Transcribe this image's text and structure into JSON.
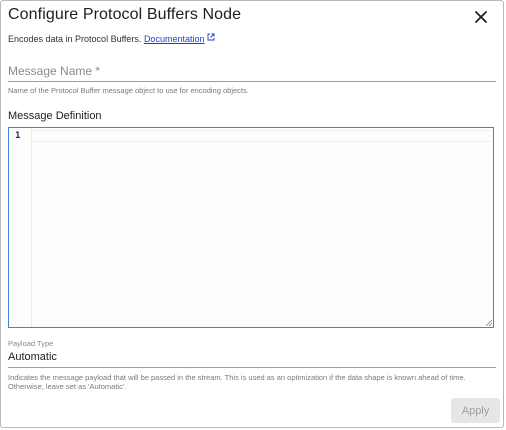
{
  "dialog": {
    "title": "Configure Protocol Buffers Node",
    "description": "Encodes data in Protocol Buffers.",
    "doc_link": "Documentation"
  },
  "message_name": {
    "label": "Message Name *",
    "helper": "Name of the Protocol Buffer message object to use for encoding objects."
  },
  "message_definition": {
    "label": "Message Definition",
    "line_numbers": [
      "1"
    ]
  },
  "payload_type": {
    "label": "Payload Type",
    "value": "Automatic",
    "helper": "Indicates the message payload that will be passed in the stream. This is used as an optimization if the data shape is known ahead of time. Otherwise, leave set as 'Automatic'."
  },
  "actions": {
    "apply": "Apply"
  },
  "icons": {
    "close": "close-icon",
    "external_link": "external-link-icon"
  },
  "colors": {
    "link": "#1a3fd0",
    "editor_focus_border": "#3b86d8",
    "disabled_button_bg": "#e6e6e6"
  }
}
